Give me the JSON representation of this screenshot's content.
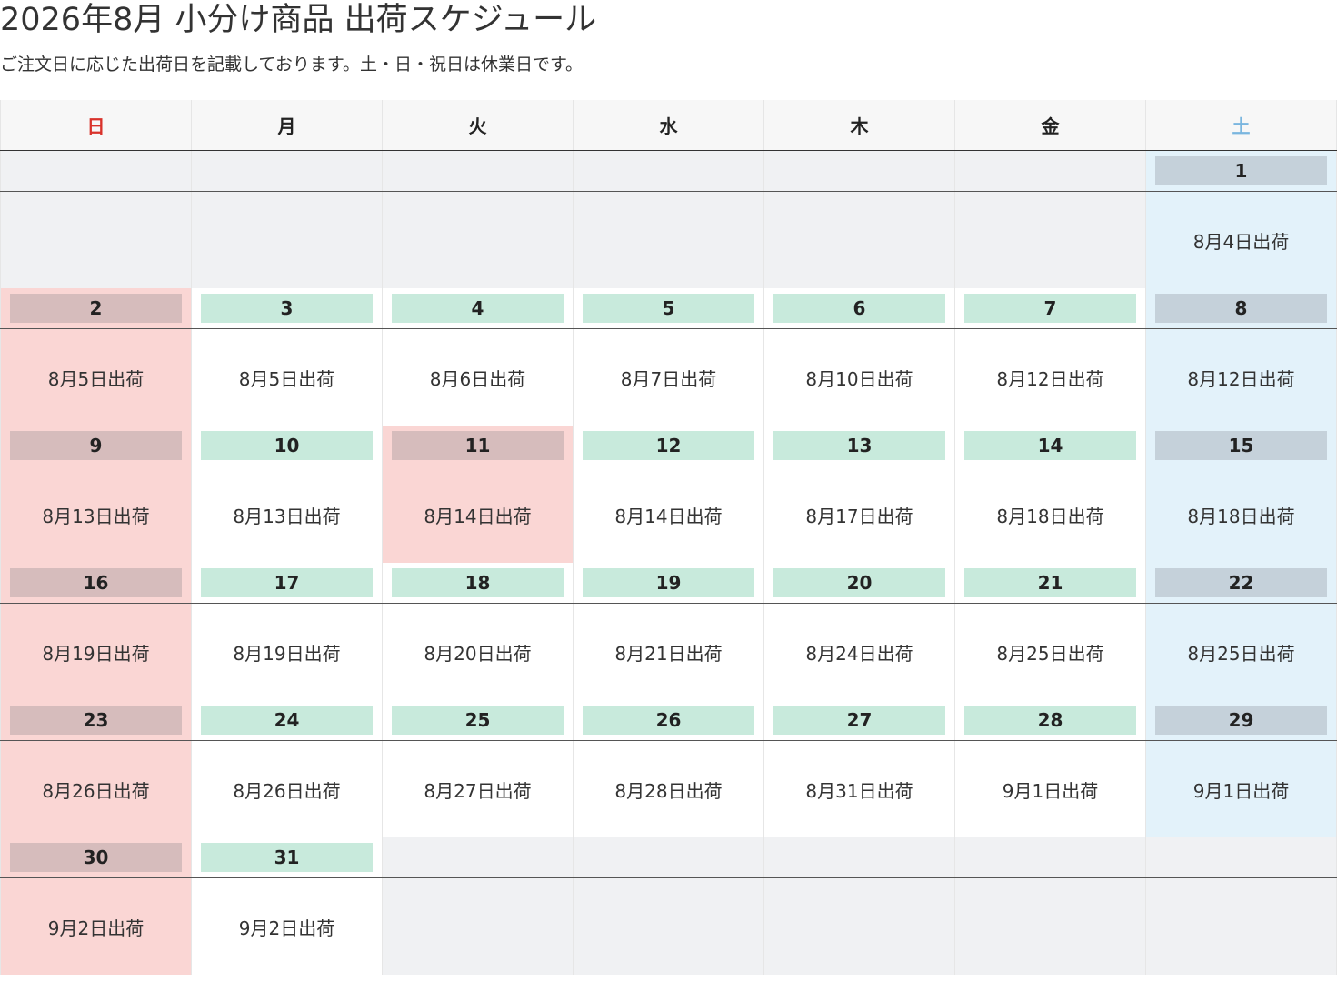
{
  "title": "2026年8月 小分け商品 出荷スケジュール",
  "subtitle": "ご注文日に応じた出荷日を記載しております。土・日・祝日は休業日です。",
  "weekdays": [
    "日",
    "月",
    "火",
    "水",
    "木",
    "金",
    "土"
  ],
  "colors": {
    "sunday_text": "#d9322b",
    "saturday_text": "#7ab6df",
    "weekday_badge": "#c8eadc",
    "holiday_badge": "#d6bcbc",
    "saturday_badge": "#c5d1da",
    "holiday_bg": "#fad6d4",
    "saturday_bg": "#e3f2fa",
    "empty_bg": "#f0f1f3"
  },
  "weeks": [
    [
      null,
      null,
      null,
      null,
      null,
      null,
      {
        "day": "1",
        "ship": "8月4日出荷",
        "kind": "saturday"
      }
    ],
    [
      {
        "day": "2",
        "ship": "8月5日出荷",
        "kind": "sunday"
      },
      {
        "day": "3",
        "ship": "8月5日出荷",
        "kind": "weekday"
      },
      {
        "day": "4",
        "ship": "8月6日出荷",
        "kind": "weekday"
      },
      {
        "day": "5",
        "ship": "8月7日出荷",
        "kind": "weekday"
      },
      {
        "day": "6",
        "ship": "8月10日出荷",
        "kind": "weekday"
      },
      {
        "day": "7",
        "ship": "8月12日出荷",
        "kind": "weekday"
      },
      {
        "day": "8",
        "ship": "8月12日出荷",
        "kind": "saturday"
      }
    ],
    [
      {
        "day": "9",
        "ship": "8月13日出荷",
        "kind": "sunday"
      },
      {
        "day": "10",
        "ship": "8月13日出荷",
        "kind": "weekday"
      },
      {
        "day": "11",
        "ship": "8月14日出荷",
        "kind": "holiday"
      },
      {
        "day": "12",
        "ship": "8月14日出荷",
        "kind": "weekday"
      },
      {
        "day": "13",
        "ship": "8月17日出荷",
        "kind": "weekday"
      },
      {
        "day": "14",
        "ship": "8月18日出荷",
        "kind": "weekday"
      },
      {
        "day": "15",
        "ship": "8月18日出荷",
        "kind": "saturday"
      }
    ],
    [
      {
        "day": "16",
        "ship": "8月19日出荷",
        "kind": "sunday"
      },
      {
        "day": "17",
        "ship": "8月19日出荷",
        "kind": "weekday"
      },
      {
        "day": "18",
        "ship": "8月20日出荷",
        "kind": "weekday"
      },
      {
        "day": "19",
        "ship": "8月21日出荷",
        "kind": "weekday"
      },
      {
        "day": "20",
        "ship": "8月24日出荷",
        "kind": "weekday"
      },
      {
        "day": "21",
        "ship": "8月25日出荷",
        "kind": "weekday"
      },
      {
        "day": "22",
        "ship": "8月25日出荷",
        "kind": "saturday"
      }
    ],
    [
      {
        "day": "23",
        "ship": "8月26日出荷",
        "kind": "sunday"
      },
      {
        "day": "24",
        "ship": "8月26日出荷",
        "kind": "weekday"
      },
      {
        "day": "25",
        "ship": "8月27日出荷",
        "kind": "weekday"
      },
      {
        "day": "26",
        "ship": "8月28日出荷",
        "kind": "weekday"
      },
      {
        "day": "27",
        "ship": "8月31日出荷",
        "kind": "weekday"
      },
      {
        "day": "28",
        "ship": "9月1日出荷",
        "kind": "weekday"
      },
      {
        "day": "29",
        "ship": "9月1日出荷",
        "kind": "saturday"
      }
    ],
    [
      {
        "day": "30",
        "ship": "9月2日出荷",
        "kind": "sunday"
      },
      {
        "day": "31",
        "ship": "9月2日出荷",
        "kind": "weekday"
      },
      null,
      null,
      null,
      null,
      null
    ]
  ]
}
